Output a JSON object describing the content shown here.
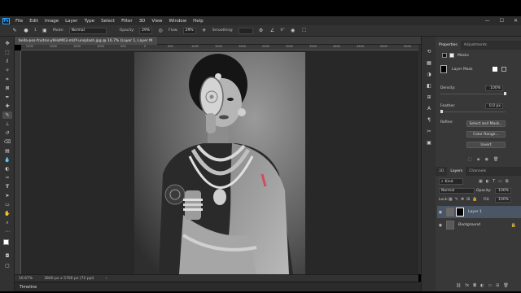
{
  "app": {
    "logo": "Ps"
  },
  "menu": [
    "File",
    "Edit",
    "Image",
    "Layer",
    "Type",
    "Select",
    "Filter",
    "3D",
    "View",
    "Window",
    "Help"
  ],
  "window_controls": [
    "—",
    "☐",
    "✕"
  ],
  "options_bar": {
    "brush_size": "1",
    "mode_label": "Mode:",
    "mode_value": "Normal",
    "opacity_label": "Opacity:",
    "opacity_value": "29%",
    "flow_label": "Flow:",
    "flow_value": "29%",
    "smoothing_label": "Smoothing:",
    "smoothing_value": "",
    "angle_value": "0°"
  },
  "document": {
    "tab_title": "bella-pos-fruitsis-y9HsMX3-mUY-unsplash.jpg @ 16.7% (Layer 1, Layer M",
    "zoom": "16.67%",
    "dimensions": "3840 px x 5760 px (72 ppi)",
    "ruler_ticks": [
      "2500",
      "2000",
      "1500",
      "1000",
      "500",
      "0",
      "500",
      "1000",
      "1500",
      "2000",
      "2500",
      "3000",
      "3500",
      "4000",
      "4500",
      "5000",
      "5500"
    ]
  },
  "timeline": {
    "label": "Timeline"
  },
  "properties": {
    "tabs": [
      "Properties",
      "Adjustments"
    ],
    "masks_label": "Masks",
    "layer_mask_label": "Layer Mask",
    "density_label": "Density:",
    "density_value": "100%",
    "feather_label": "Feather:",
    "feather_value": "0.0 px",
    "refine_label": "Refine:",
    "buttons": [
      "Select and Mask...",
      "Color Range...",
      "Invert"
    ]
  },
  "layers": {
    "tabs": [
      "3D",
      "Layers",
      "Channels"
    ],
    "kind_label": "Kind",
    "blend_mode": "Normal",
    "opacity_label": "Opacity:",
    "opacity_value": "100%",
    "lock_label": "Lock:",
    "fill_label": "Fill:",
    "fill_value": "100%",
    "items": [
      {
        "name": "Layer 1",
        "selected": true
      },
      {
        "name": "Background",
        "selected": false
      }
    ]
  },
  "colors": {
    "accent": "#31a8ff",
    "selected_layer": "#4a5566"
  }
}
